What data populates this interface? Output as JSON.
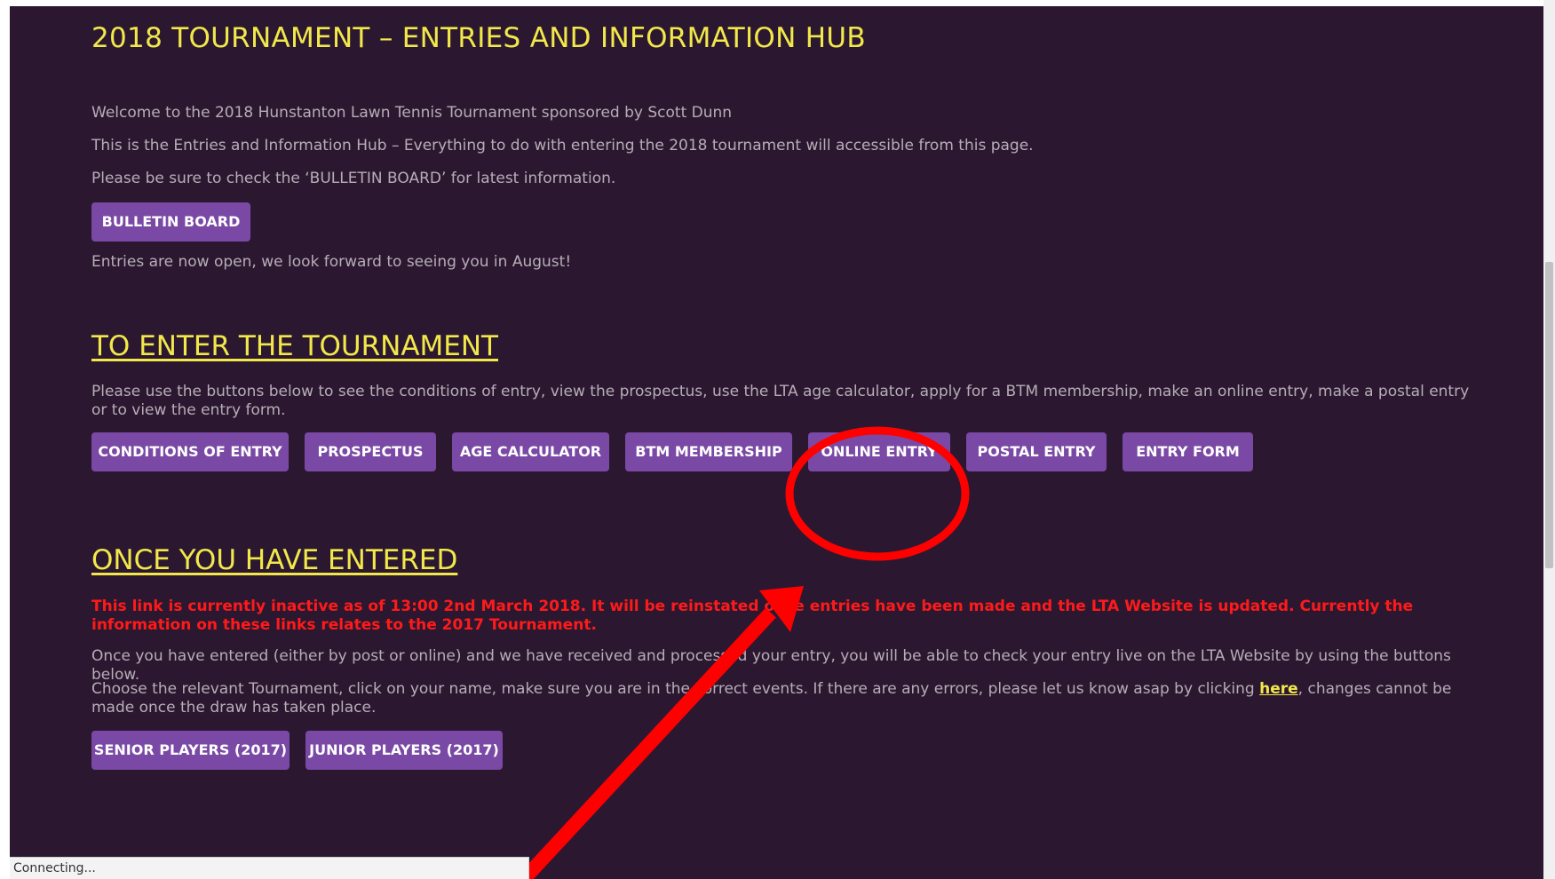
{
  "hub": {
    "title": "2018 TOURNAMENT – ENTRIES AND INFORMATION HUB",
    "intro": [
      "Welcome to the 2018 Hunstanton Lawn Tennis Tournament sponsored by Scott Dunn",
      "This is the Entries and Information Hub – Everything to do with entering the 2018 tournament will accessible from this page.",
      "Please be sure to check the ‘BULLETIN BOARD’ for latest information."
    ],
    "bulletin_button": "BULLETIN BOARD",
    "entries_open": "Entries are now open, we look forward to seeing you in August!"
  },
  "enter_section": {
    "heading": "TO ENTER THE TOURNAMENT",
    "description": "Please use the buttons below to see the conditions of entry, view the prospectus, use the LTA age calculator, apply for a BTM membership, make an online entry, make a postal entry or to view the entry form.",
    "buttons": [
      "CONDITIONS OF ENTRY",
      "PROSPECTUS",
      "AGE CALCULATOR",
      "BTM MEMBERSHIP",
      "ONLINE ENTRY",
      "POSTAL ENTRY",
      "ENTRY FORM"
    ]
  },
  "entered_section": {
    "heading": "ONCE YOU HAVE ENTERED",
    "warning": "This link is currently inactive as of 13:00 2nd March 2018. It will be reinstated once entries have been made and the LTA Website is updated. Currently the information on these links relates to the 2017 Tournament.",
    "para1": "Once you have entered (either by post or online) and we have received and processed your entry, you will be able to check your entry live on the LTA Website by using the buttons below.",
    "para2_before": "Choose the relevant Tournament, click on your name, make sure you are in the correct events. If there are any errors, please let us know asap by clicking ",
    "para2_link": "here",
    "para2_after": ", changes cannot be made once the draw has taken place.",
    "buttons": [
      "SENIOR PLAYERS (2017)",
      "JUNIOR PLAYERS (2017)"
    ]
  },
  "status_bar": {
    "text": "Connecting..."
  },
  "annotation": {
    "color": "#ff0000"
  }
}
